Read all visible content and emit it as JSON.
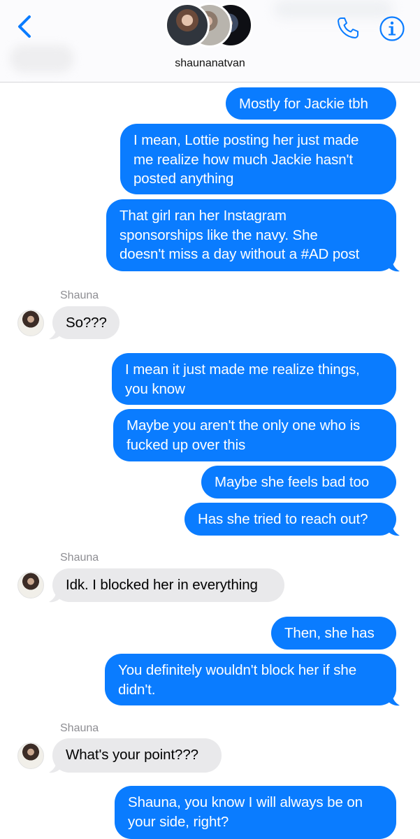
{
  "header": {
    "contact_name": "shaunanatvan",
    "back_icon": "chevron-left-icon",
    "call_icon": "phone-icon",
    "info_icon": "info-icon",
    "accent_color": "#0a7cff"
  },
  "colors": {
    "outgoing_bubble": "#0a7cff",
    "incoming_bubble": "#e9e9eb",
    "sender_label": "#8e8e93"
  },
  "messages": [
    {
      "direction": "out",
      "text": "Mostly for Jackie tbh"
    },
    {
      "direction": "out",
      "text": "I mean, Lottie posting her just made\nme realize how much Jackie hasn't\nposted anything"
    },
    {
      "direction": "out",
      "text": "That girl ran her Instagram\nsponsorships like the navy. She\ndoesn't miss a day without a #AD post"
    },
    {
      "direction": "in",
      "sender": "Shauna",
      "text": "So???"
    },
    {
      "direction": "out",
      "text": "I mean it just made me realize things,\nyou know"
    },
    {
      "direction": "out",
      "text": "Maybe you aren't the only one who is\nfucked up over this"
    },
    {
      "direction": "out",
      "text": "Maybe she feels bad too"
    },
    {
      "direction": "out",
      "text": "Has she tried to reach out?"
    },
    {
      "direction": "in",
      "sender": "Shauna",
      "text": "Idk. I blocked her in everything"
    },
    {
      "direction": "out",
      "text": "Then, she has"
    },
    {
      "direction": "out",
      "text": "You definitely wouldn't block her if she\ndidn't."
    },
    {
      "direction": "in",
      "sender": "Shauna",
      "text": "What's your point???"
    },
    {
      "direction": "out",
      "text": "Shauna, you know I will always be on\nyour side, right?"
    }
  ]
}
